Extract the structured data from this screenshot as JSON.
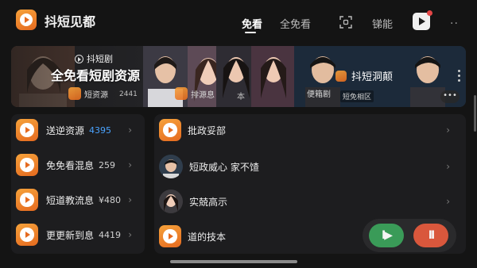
{
  "header": {
    "title": "抖短见都",
    "tabs": [
      {
        "label": "免看",
        "active": true
      },
      {
        "label": "全免看",
        "active": false
      },
      {
        "label": "锑能",
        "active": false
      }
    ],
    "icons": [
      "scan-icon",
      "player-icon",
      "more-icon"
    ],
    "more_glyph": "··"
  },
  "banner": {
    "brand": "抖短剧",
    "headline": "全免看短剧资源",
    "chips": [
      {
        "label": "短资源",
        "num": "2441"
      },
      {
        "label": "排源息",
        "num": "本"
      },
      {
        "label": "便箱剧",
        "sub": "短免相区"
      }
    ],
    "right_title": "抖短洞颠",
    "more_glyph": "•••"
  },
  "left_list": [
    {
      "label": "送逆资源",
      "num": "4395",
      "num_color": "blue"
    },
    {
      "label": "免免看混息",
      "num": "259",
      "num_color": "plain"
    },
    {
      "label": "短道教流息",
      "num": "¥480",
      "num_color": "plain"
    },
    {
      "label": "更更新到息",
      "num": "4419",
      "num_color": "plain"
    }
  ],
  "right_list": [
    {
      "label": "批政妥部",
      "kind": "logo"
    },
    {
      "label": "短政威心  家不馇",
      "kind": "avatar-male"
    },
    {
      "label": "实兢高示",
      "kind": "avatar-female"
    },
    {
      "label": "道的技本",
      "kind": "logo"
    }
  ],
  "chevron": "›",
  "colors": {
    "accent_orange": "#e56a1f",
    "accent_blue": "#4aa3ff",
    "play_green": "#3a9b58",
    "pause_red": "#d9573c"
  },
  "float_buttons": {
    "play": "I▶",
    "pause": "II"
  }
}
